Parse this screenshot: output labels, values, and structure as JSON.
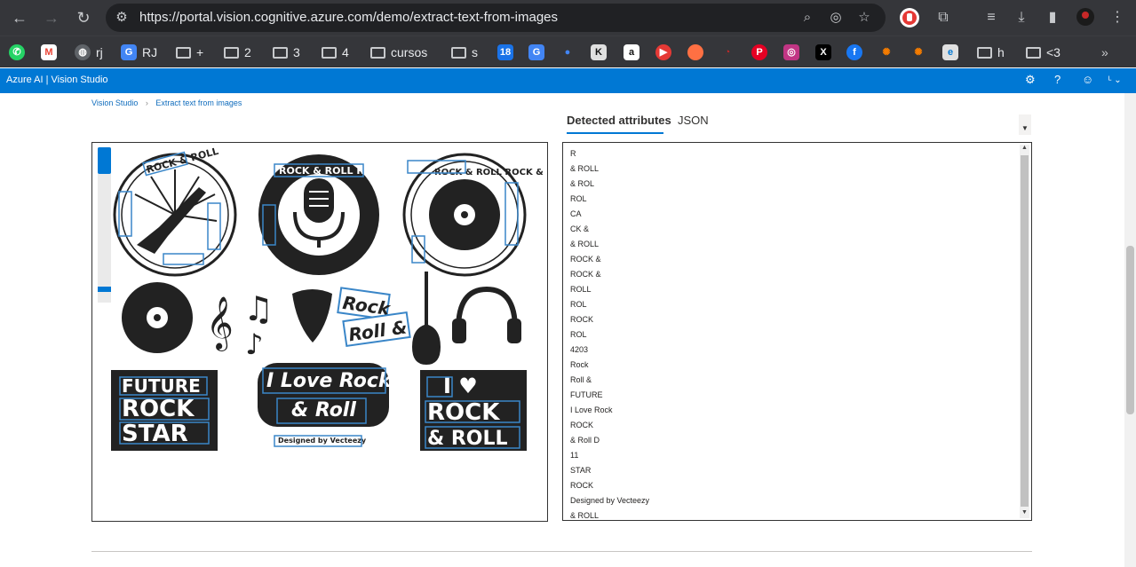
{
  "browser": {
    "url": "https://portal.vision.cognitive.azure.com/demo/extract-text-from-images",
    "bookmarks": [
      {
        "label": "",
        "icon": "whatsapp-icon",
        "color": "#25d366"
      },
      {
        "label": "",
        "icon": "gmail-icon",
        "color": "#ea4335"
      },
      {
        "label": "rj",
        "icon": "globe-icon",
        "color": "#5f6368"
      },
      {
        "label": "RJ",
        "icon": "rj-app-icon",
        "color": "#4285f4"
      },
      {
        "label": "+",
        "icon": "folder-icon"
      },
      {
        "label": "2",
        "icon": "folder-icon"
      },
      {
        "label": "3",
        "icon": "folder-icon"
      },
      {
        "label": "4",
        "icon": "folder-icon"
      },
      {
        "label": "cursos",
        "icon": "folder-icon"
      },
      {
        "label": "s",
        "icon": "folder-icon"
      },
      {
        "label": "h",
        "icon": "folder-icon"
      },
      {
        "label": "<3",
        "icon": "folder-icon"
      }
    ]
  },
  "app": {
    "title": "Azure AI  |  Vision Studio",
    "brand_color": "#0078d4"
  },
  "breadcrumb": {
    "root": "Vision Studio",
    "separator": "›",
    "current": "Extract text from images"
  },
  "tabs": [
    {
      "label": "Detected attributes",
      "active": true
    },
    {
      "label": "JSON",
      "active": false
    }
  ],
  "detected_lines": [
    "R",
    "& ROLL",
    "& ROL",
    "ROL",
    "CA",
    "CK &",
    "& ROLL",
    "ROCK &",
    "ROCK &",
    "ROLL",
    "ROL",
    "ROCK",
    "ROL",
    "4203",
    "Rock",
    "Roll &",
    "FUTURE",
    "I Love Rock",
    "ROCK",
    "& Roll D",
    "11",
    "STAR",
    "ROCK",
    "Designed by Vecteezy",
    "& ROLL"
  ],
  "image_text": {
    "badge1_top": "ROCK & ROLL",
    "badge2_ring": "ROCK & ROLL ROCK & ROLL",
    "badge3_ring": "ROCK & ROLL ROCK & ROLL",
    "sticker_rock": "Rock",
    "sticker_roll": "Roll &",
    "future_1": "FUTURE",
    "future_2": "ROCK",
    "future_3": "STAR",
    "love_1": "I Love Rock",
    "love_2": "& Roll",
    "credit": "Designed by Vecteezy",
    "heart_1": "I ♥",
    "heart_2": "ROCK",
    "heart_3": "& ROLL"
  }
}
